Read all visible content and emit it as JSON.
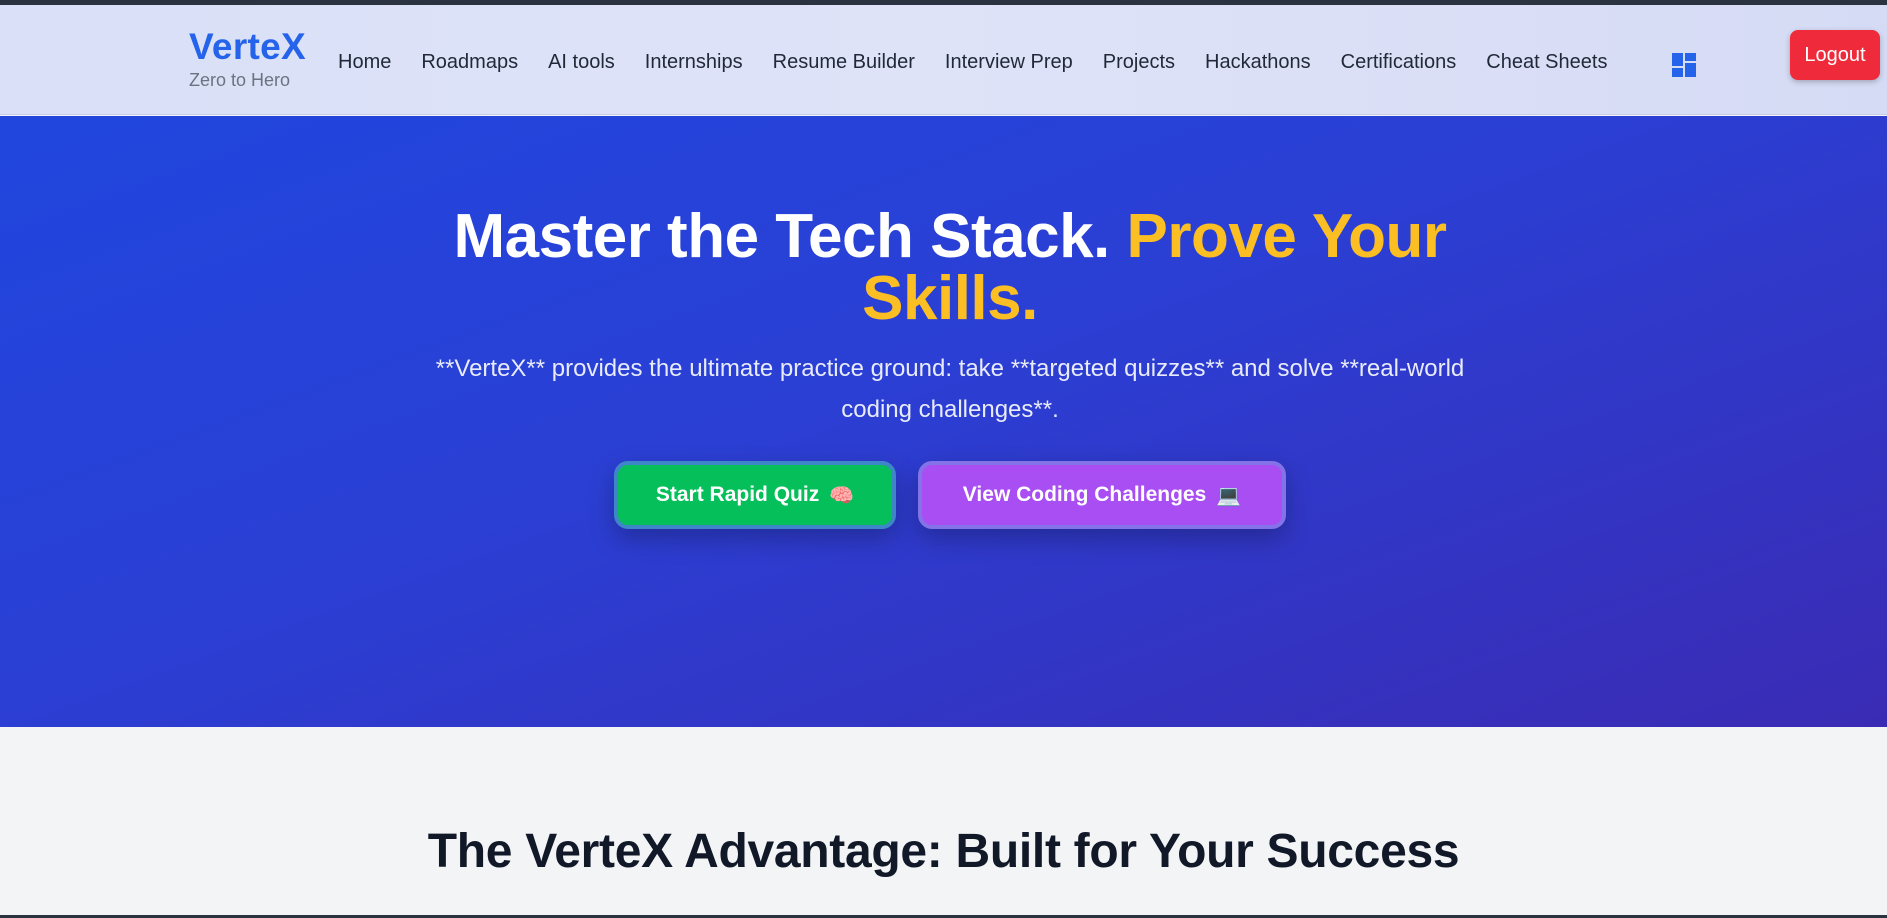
{
  "brand": {
    "name": "VerteX",
    "tagline": "Zero to Hero"
  },
  "nav": {
    "items": [
      {
        "label": "Home"
      },
      {
        "label": "Roadmaps"
      },
      {
        "label": "AI tools"
      },
      {
        "label": "Internships"
      },
      {
        "label": "Resume Builder"
      },
      {
        "label": "Interview Prep"
      },
      {
        "label": "Projects"
      },
      {
        "label": "Hackathons"
      },
      {
        "label": "Certifications"
      },
      {
        "label": "Cheat Sheets"
      }
    ],
    "dashboard_icon": "dashboard-icon",
    "logout_label": "Logout"
  },
  "hero": {
    "title_main": "Master the Tech Stack. ",
    "title_accent": "Prove Your Skills.",
    "subtitle": "**VerteX** provides the ultimate practice ground: take **targeted quizzes** and solve **real-world coding challenges**.",
    "primary_button": {
      "label": "Start Rapid Quiz",
      "emoji": "🧠"
    },
    "secondary_button": {
      "label": "View Coding Challenges",
      "emoji": "💻"
    }
  },
  "advantage": {
    "title": "The VerteX Advantage: Built for Your Success"
  },
  "colors": {
    "brand": "#2563eb",
    "accent": "#fbbf24",
    "logout": "#ef2b3b",
    "quiz_button": "#05c05a",
    "challenges_button": "#a84ef2"
  }
}
